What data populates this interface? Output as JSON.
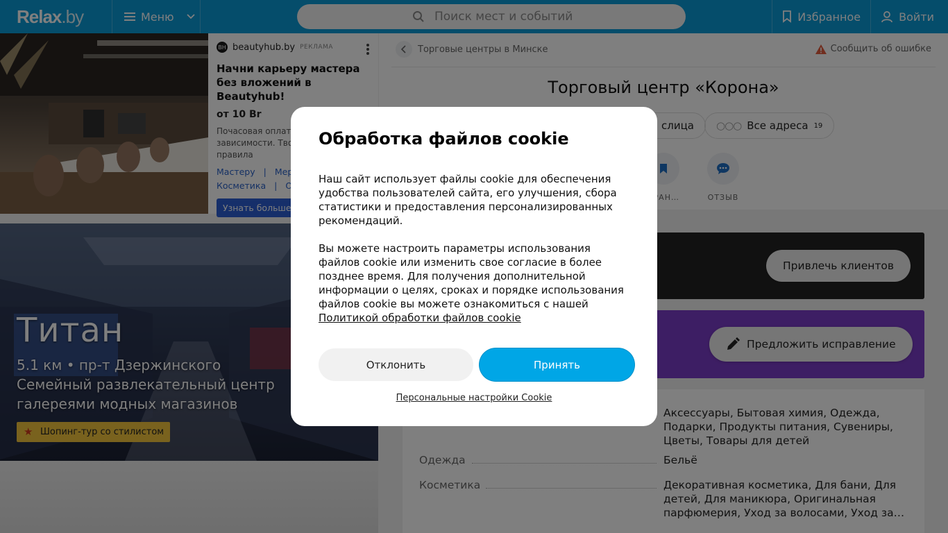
{
  "header": {
    "logo_main": "Relax",
    "logo_suffix": ".by",
    "menu_label": "Меню",
    "search_placeholder": "Поиск мест и событий",
    "favorites_label": "Избранное",
    "login_label": "Войти",
    "accent_color": "#0a9ad6"
  },
  "ad": {
    "brand": "beautyhub.by",
    "tag": "РЕКЛАМА",
    "title": "Начни карьеру мастера без вложений в Beautyhub!",
    "price": "от 10 Br",
    "desc_line1": "Почасовая оплата",
    "desc_line2": "зависимости. Тво",
    "desc_line3": "правила",
    "link1": "Мастеру",
    "sep1": "|",
    "link2": "Мерч",
    "link3": "Косметика",
    "sep2": "|",
    "link4": "О н",
    "cta": "Узнать больше"
  },
  "promo": {
    "name": "Титан",
    "distance_line": "5.1 км • пр-т Дзержинского",
    "desc_line1": "Семейный развлекательный центр",
    "desc_line2": "галереями модных магазинов",
    "badge": "Шопинг-тур со стилистом"
  },
  "place": {
    "breadcrumb": "Торговые центры в Минске",
    "report_label": "Сообщить об ошибке",
    "title": "Торговый центр «Корона»",
    "chip_street": "слица",
    "chip_addresses": "Все адреса",
    "chip_addresses_count": "19",
    "action_favorite": "БРАН…",
    "action_review": "ОТЗЫВ",
    "attract_button": "Привлечь клиентов",
    "suggest_button": "Предложить исправление"
  },
  "info": {
    "row1_value": "Аксессуары, Бытовая химия, Одежда, Подарки, Продукты питания, Сувениры, Цветы, Товары для детей",
    "row2_key": "Одежда",
    "row2_value": "Бельё",
    "row3_key": "Косметика",
    "row3_value": "Декоративная косметика, Для бани, Для детей, Для маникюра, Оригинальная парфюмерия, Уход за волосами, Уход за…"
  },
  "cookie_modal": {
    "title": "Обработка файлов cookie",
    "paragraph1": "Наш сайт использует файлы cookie для обеспечения удобства пользователей сайта, его улучшения, сбора статистики и предоставления персонализированных рекомендаций.",
    "paragraph2": "Вы можете настроить параметры использования файлов cookie или изменить свое согласие в более позднее время. Для получения дополнительной информации о целях, сроках и порядке использования файлов cookie вы можете ознакомиться с нашей",
    "policy_link": "Политикой обработки файлов cookie",
    "decline_button": "Отклонить",
    "accept_button": "Принять",
    "settings_link": "Персональные настройки Cookie",
    "accept_color": "#00a6e6"
  }
}
